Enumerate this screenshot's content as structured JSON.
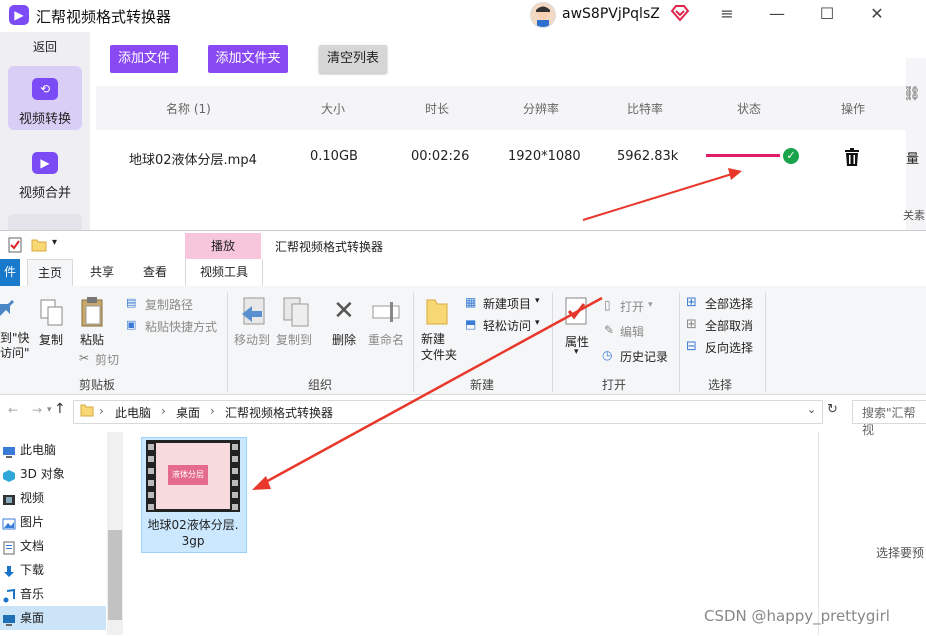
{
  "app": {
    "title": "汇帮视频格式转换器",
    "username": "awS8PVjPqlsZ",
    "sidebar": {
      "back": "返回",
      "items": [
        {
          "label": "视频转换",
          "active": true
        },
        {
          "label": "视频合并",
          "active": false
        }
      ]
    },
    "toolbar": {
      "add_file": "添加文件",
      "add_folder": "添加文件夹",
      "clear_list": "清空列表"
    },
    "table": {
      "headers": [
        "名称 (1)",
        "大小",
        "时长",
        "分辨率",
        "比特率",
        "状态",
        "操作"
      ],
      "rows": [
        {
          "name": "地球02液体分层.mp4",
          "size": "0.10GB",
          "duration": "00:02:26",
          "resolution": "1920*1080",
          "bitrate": "5962.83k",
          "progress": 1.0
        }
      ]
    },
    "right_panel_fragments": [
      "量",
      "关素"
    ],
    "colors": {
      "accent": "#8a4af3",
      "progress": "#e21d66",
      "done": "#19a34a"
    }
  },
  "explorer": {
    "title": "汇帮视频格式转换器",
    "context_tab": "播放",
    "context_subtab": "视频工具",
    "tabs": [
      "件",
      "主页",
      "共享",
      "查看"
    ],
    "ribbon": {
      "clipboard": {
        "pin_label": "到\"快\n访问\"",
        "copy": "复制",
        "paste": "粘贴",
        "copy_path": "复制路径",
        "paste_shortcut": "粘贴快捷方式",
        "cut": "剪切",
        "group": "剪贴板"
      },
      "organize": {
        "move_to": "移动到",
        "copy_to": "复制到",
        "delete": "删除",
        "rename": "重命名",
        "group": "组织"
      },
      "new": {
        "new_folder": "新建\n文件夹",
        "new_item": "新建项目",
        "easy_access": "轻松访问",
        "group": "新建"
      },
      "open": {
        "properties": "属性",
        "open": "打开",
        "edit": "编辑",
        "history": "历史记录",
        "group": "打开"
      },
      "select": {
        "select_all": "全部选择",
        "select_none": "全部取消",
        "invert": "反向选择",
        "group": "选择"
      }
    },
    "address": {
      "crumbs": [
        "此电脑",
        "桌面",
        "汇帮视频格式转换器"
      ],
      "search_placeholder": "搜索\"汇帮视"
    },
    "nav": [
      {
        "label": "此电脑",
        "icon": "pc-icon",
        "selected": false
      },
      {
        "label": "3D 对象",
        "icon": "cube-icon",
        "selected": false
      },
      {
        "label": "视频",
        "icon": "film-icon",
        "selected": false
      },
      {
        "label": "图片",
        "icon": "picture-icon",
        "selected": false
      },
      {
        "label": "文档",
        "icon": "document-icon",
        "selected": false
      },
      {
        "label": "下载",
        "icon": "download-icon",
        "selected": false
      },
      {
        "label": "音乐",
        "icon": "music-icon",
        "selected": false
      },
      {
        "label": "桌面",
        "icon": "desktop-icon",
        "selected": true
      }
    ],
    "file": {
      "name_line1": "地球02液体分层.",
      "name_line2": "3gp",
      "thumb_text": "液体分层"
    },
    "preview_hint": "选择要预"
  },
  "watermark": "CSDN @happy_prettygirl"
}
